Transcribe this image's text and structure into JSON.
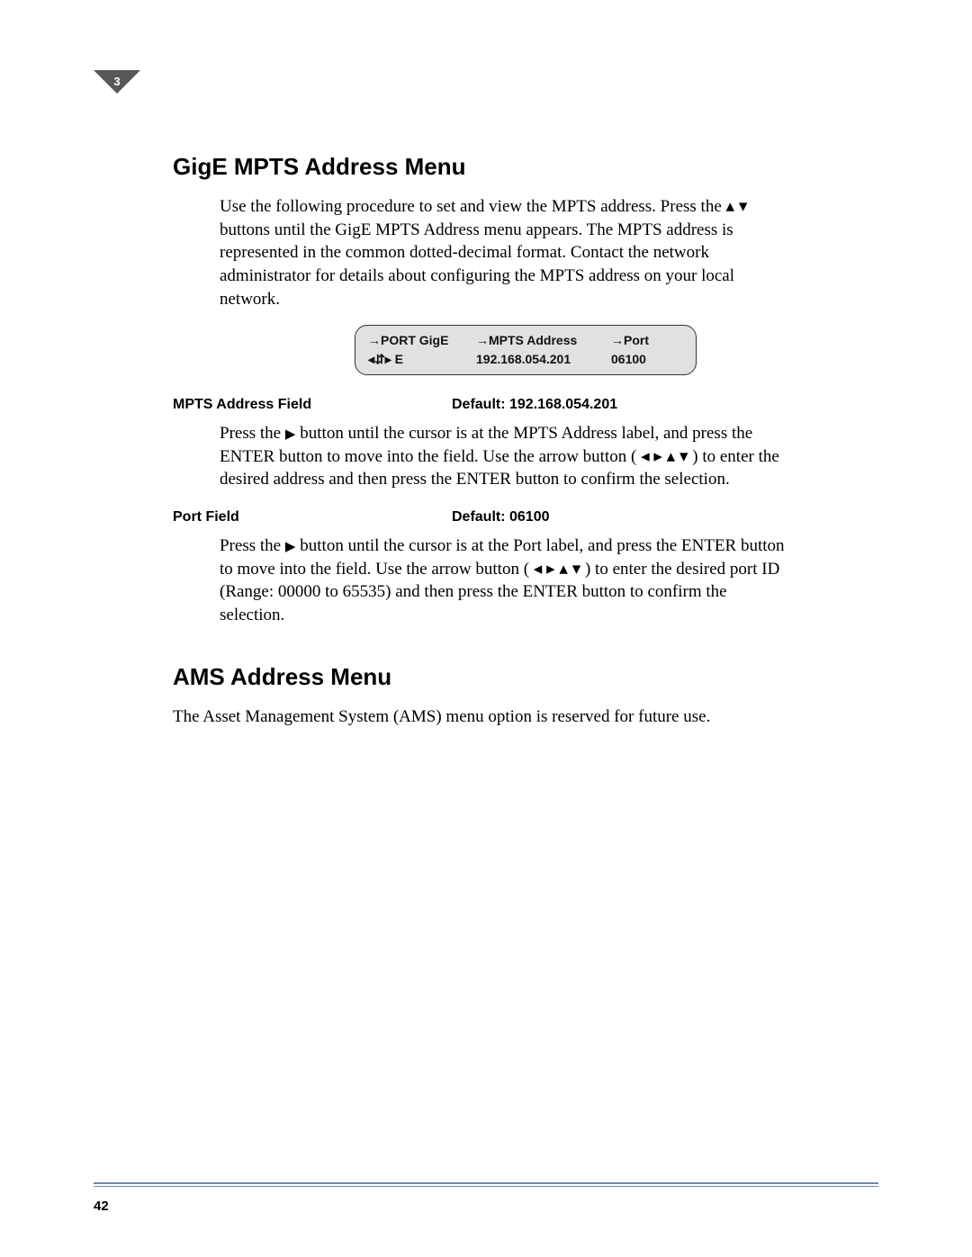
{
  "chapter_number": "3",
  "page_number": "42",
  "section1": {
    "heading": "GigE MPTS Address Menu",
    "intro_before_glyph": "Use the following procedure to set and view the MPTS address. Press the ",
    "intro_after_glyph": " buttons until the GigE MPTS Address menu appears. The MPTS address is represented in the common dotted-decimal format. Contact the network administrator for details about configuring the MPTS address on your local network."
  },
  "lcd": {
    "row1": {
      "c1": "→PORT GigE",
      "c2": "→MPTS Address",
      "c3": "→Port"
    },
    "row2": {
      "c1": "◂⇵▸ E",
      "c2": "192.168.054.201",
      "c3": "06100"
    }
  },
  "field1": {
    "label": "MPTS Address Field",
    "default": "Default: 192.168.054.201",
    "para_a": "Press the ",
    "para_b": " button until the cursor is at the MPTS Address label, and press the ENTER button to move into the field. Use the arrow button ( ",
    "para_c": " ) to enter the desired address and then press the ENTER button to confirm the selection."
  },
  "field2": {
    "label": "Port Field",
    "default": "Default: 06100",
    "para_a": "Press the ",
    "para_b": "  button until the cursor is at the Port label, and press the ENTER button to move into the field. Use the arrow button ( ",
    "para_c": " ) to enter the desired port ID (Range: 00000 to 65535) and then press the ENTER button to confirm the selection."
  },
  "section2": {
    "heading": "AMS Address Menu",
    "para": "The Asset Management System (AMS) menu option is reserved for future use."
  }
}
